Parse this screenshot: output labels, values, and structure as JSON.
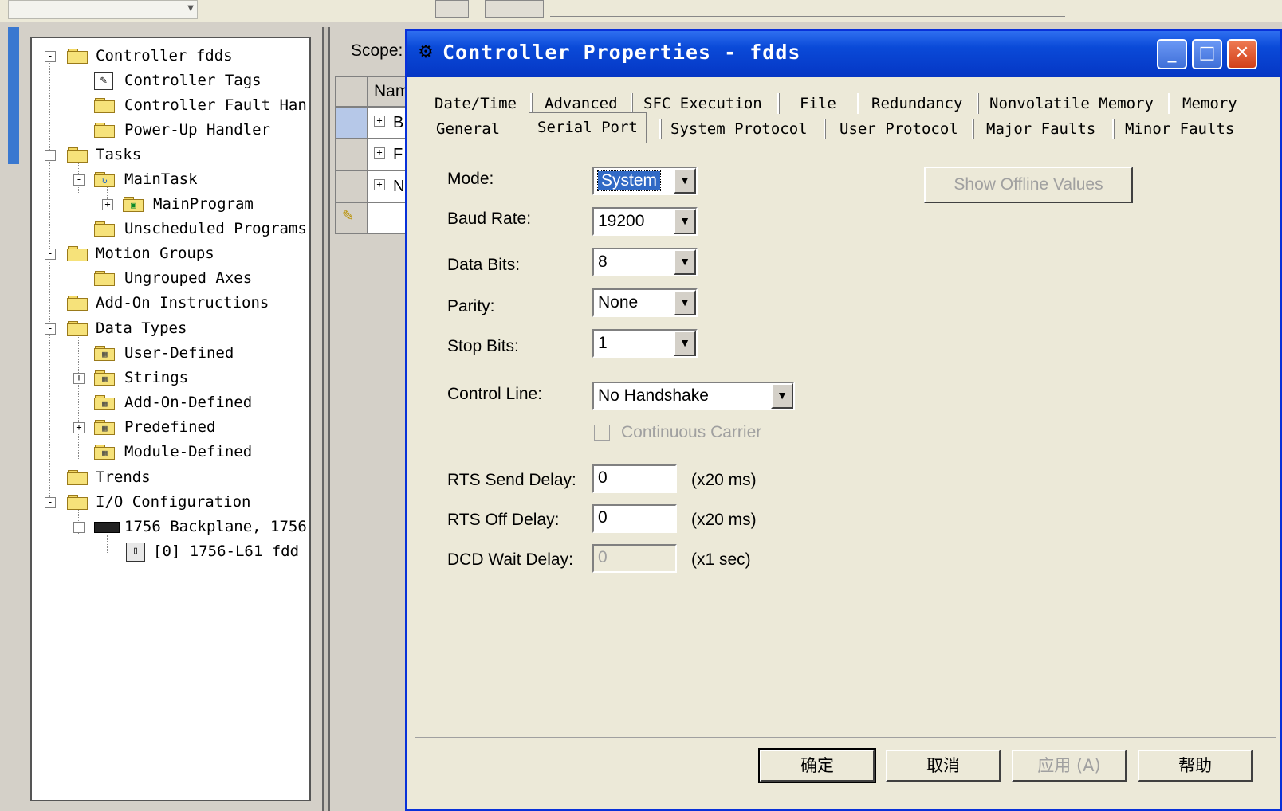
{
  "tree": {
    "items": [
      {
        "label": "Controller fdds",
        "exp": "-"
      },
      {
        "label": "Controller Tags",
        "exp": ""
      },
      {
        "label": "Controller Fault Han",
        "exp": ""
      },
      {
        "label": "Power-Up Handler",
        "exp": ""
      },
      {
        "label": "Tasks",
        "exp": "-"
      },
      {
        "label": "MainTask",
        "exp": "-"
      },
      {
        "label": "MainProgram",
        "exp": "+"
      },
      {
        "label": "Unscheduled Programs",
        "exp": ""
      },
      {
        "label": "Motion Groups",
        "exp": "-"
      },
      {
        "label": "Ungrouped Axes",
        "exp": ""
      },
      {
        "label": "Add-On Instructions",
        "exp": ""
      },
      {
        "label": "Data Types",
        "exp": "-"
      },
      {
        "label": "User-Defined",
        "exp": ""
      },
      {
        "label": "Strings",
        "exp": "+"
      },
      {
        "label": "Add-On-Defined",
        "exp": ""
      },
      {
        "label": "Predefined",
        "exp": "+"
      },
      {
        "label": "Module-Defined",
        "exp": ""
      },
      {
        "label": "Trends",
        "exp": ""
      },
      {
        "label": "I/O Configuration",
        "exp": "-"
      },
      {
        "label": "1756 Backplane, 1756",
        "exp": "-"
      },
      {
        "label": "[0] 1756-L61 fdd",
        "exp": ""
      }
    ]
  },
  "scope_label": "Scope:",
  "grid": {
    "name_header": "Nam",
    "rows": [
      {
        "exp": "+",
        "text": "B"
      },
      {
        "exp": "+",
        "text": "F"
      },
      {
        "exp": "+",
        "text": "N"
      }
    ]
  },
  "dialog": {
    "title": "Controller Properties - fdds",
    "tabs_top": [
      "Date/Time",
      "Advanced",
      "SFC Execution",
      "File",
      "Redundancy",
      "Nonvolatile Memory",
      "Memory"
    ],
    "tabs_bottom": [
      "General",
      "Serial Port",
      "System Protocol",
      "User Protocol",
      "Major Faults",
      "Minor Faults"
    ],
    "active_tab": "Serial Port",
    "fields": {
      "mode_label": "Mode:",
      "mode_value": "System",
      "baud_label": "Baud Rate:",
      "baud_value": "19200",
      "databits_label": "Data Bits:",
      "databits_value": "8",
      "parity_label": "Parity:",
      "parity_value": "None",
      "stopbits_label": "Stop Bits:",
      "stopbits_value": "1",
      "controlline_label": "Control Line:",
      "controlline_value": "No Handshake",
      "continuous_carrier_label": "Continuous Carrier",
      "rts_send_label": "RTS Send Delay:",
      "rts_send_value": "0",
      "rts_send_unit": "(x20 ms)",
      "rts_off_label": "RTS Off Delay:",
      "rts_off_value": "0",
      "rts_off_unit": "(x20 ms)",
      "dcd_label": "DCD Wait Delay:",
      "dcd_value": "0",
      "dcd_unit": "(x1 sec)"
    },
    "show_offline_label": "Show Offline Values",
    "buttons": {
      "ok": "确定",
      "cancel": "取消",
      "apply": "应用 (A)",
      "help": "帮助"
    }
  }
}
